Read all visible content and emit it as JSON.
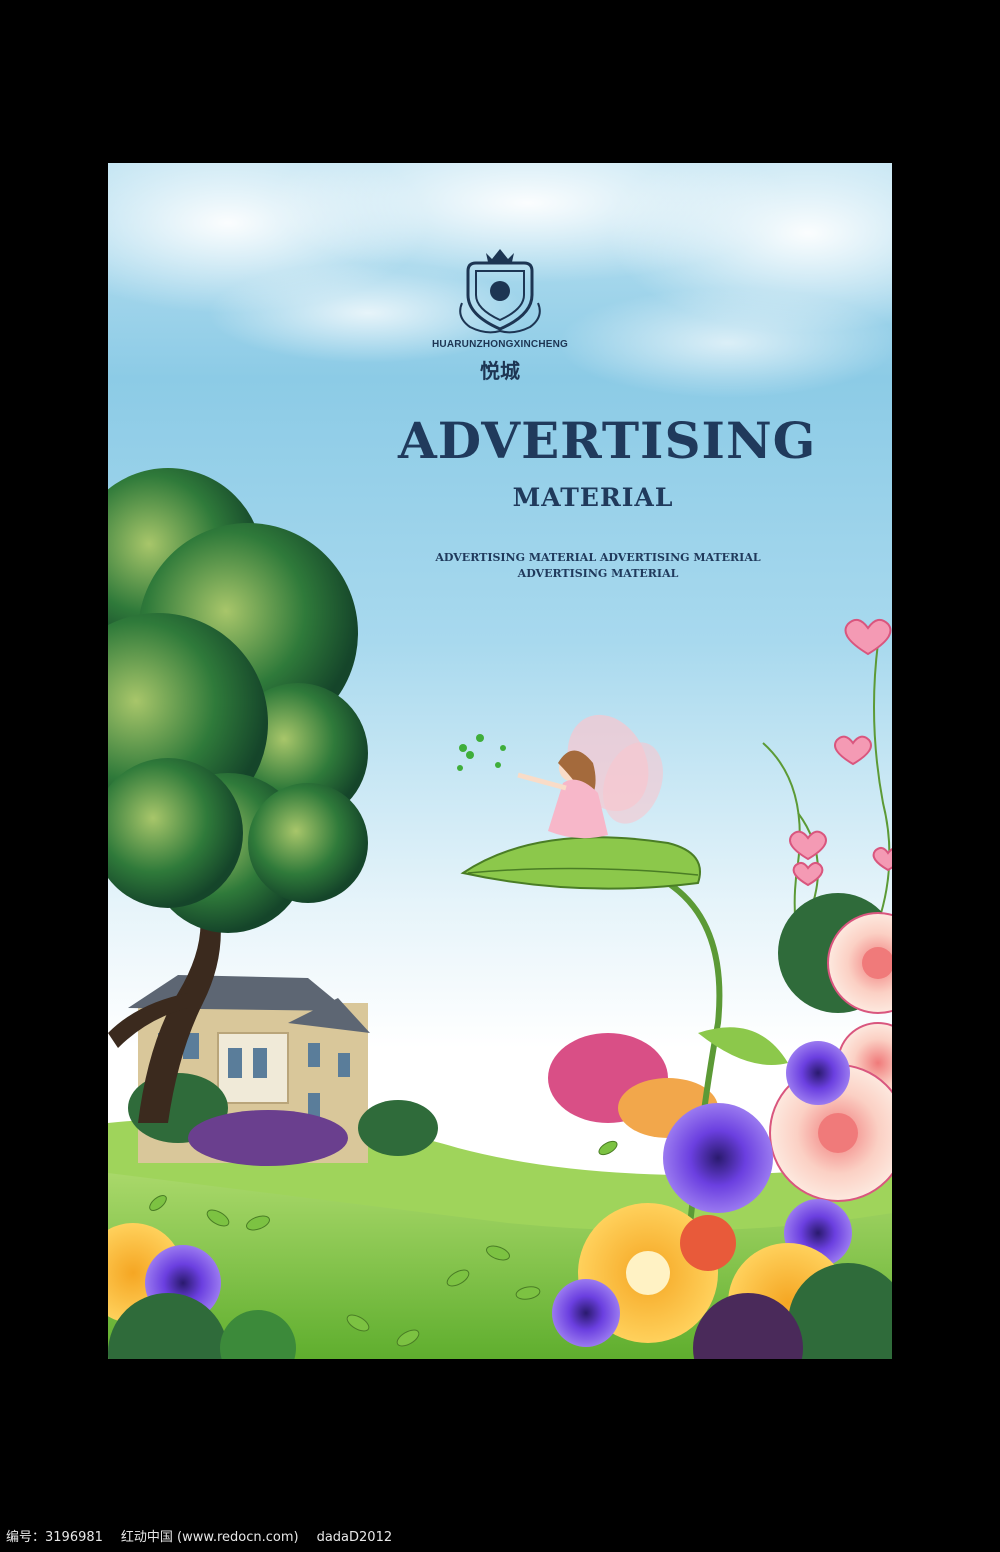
{
  "poster": {
    "brand_en": "HUARUNZHONGXINCHENG",
    "brand_cn": "悦城",
    "title": "ADVERTISING",
    "subtitle": "MATERIAL",
    "tagline_line1": "ADVERTISING MATERIAL ADVERTISING MATERIAL",
    "tagline_line2": "ADVERTISING MATERIAL",
    "logo_icon": "crest-shield-icon"
  },
  "footer": {
    "id_label": "编号：3196981",
    "site": "红动中国 (www.redocn.com)",
    "author": "dadaD2012"
  },
  "colors": {
    "title": "#203a5c",
    "sky": "#8ccbe6",
    "grass": "#7cc242",
    "background": "#000000"
  }
}
